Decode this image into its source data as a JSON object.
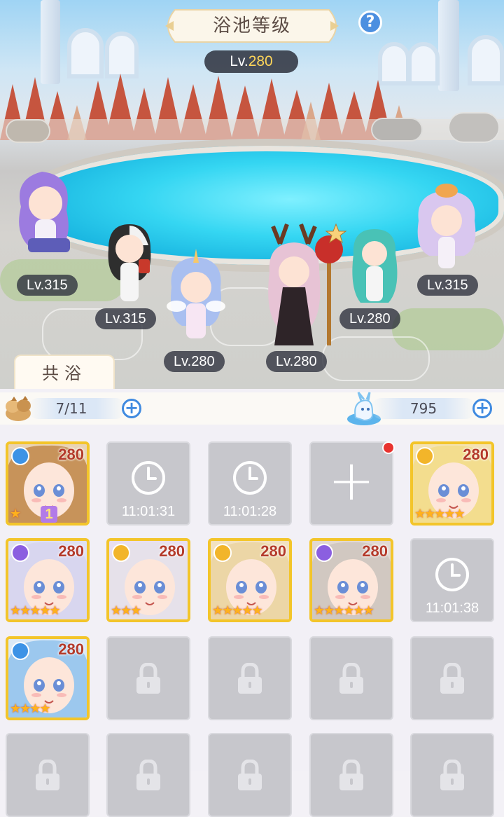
{
  "header": {
    "title": "浴池等级",
    "help_label": "?",
    "pool_level_prefix": "Lv.",
    "pool_level_value": "280"
  },
  "characters": [
    {
      "level": "Lv.315",
      "hair": "#9c7be0"
    },
    {
      "level": "Lv.315",
      "hair": "#2e2e2e"
    },
    {
      "level": "Lv.280",
      "hair": "#a9bff0"
    },
    {
      "level": "Lv.280",
      "hair": "#e7c3d5"
    },
    {
      "level": "Lv.280",
      "hair": "#49c2b6"
    },
    {
      "level": "Lv.315",
      "hair": "#d9c7ef"
    }
  ],
  "tab": {
    "label": "共浴"
  },
  "resources": {
    "capacity": {
      "icon": "supply-bag-icon",
      "value": "7/11"
    },
    "energy": {
      "icon": "water-spirit-icon",
      "value": "795"
    }
  },
  "slots": [
    {
      "type": "card",
      "level": "280",
      "stars": "★",
      "extra": "1",
      "badge_color": "#3d93e6",
      "hair": "#c7935a",
      "bg": "#e9d3b5"
    },
    {
      "type": "timer",
      "time": "11:01:31"
    },
    {
      "type": "timer",
      "time": "11:01:28"
    },
    {
      "type": "add",
      "label": "+"
    },
    {
      "type": "card",
      "level": "280",
      "stars": "★★★★★",
      "badge_color": "#f2b52a",
      "hair": "#f3dd8e",
      "bg": "#f4e3b2"
    },
    {
      "type": "card",
      "level": "280",
      "stars": "★★★★★",
      "badge_color": "#8b5fe0",
      "hair": "#d8d6ef",
      "bg": "#dfe1f2"
    },
    {
      "type": "card",
      "level": "280",
      "stars": "★★★",
      "badge_color": "#f2b52a",
      "hair": "#e6e1ea",
      "bg": "#e9dff0"
    },
    {
      "type": "card",
      "level": "280",
      "stars": "★★★★★",
      "badge_color": "#f2b52a",
      "hair": "#ecd6a6",
      "bg": "#f2e2c2"
    },
    {
      "type": "card",
      "level": "280",
      "stars": "★★★★★★",
      "badge_color": "#8b5fe0",
      "hair": "#d1c8c1",
      "bg": "#e2d9d2"
    },
    {
      "type": "timer",
      "time": "11:01:38"
    },
    {
      "type": "card",
      "level": "280",
      "stars": "★★★★",
      "badge_color": "#3d93e6",
      "hair": "#9cc8ee",
      "bg": "#dbe9f6"
    },
    {
      "type": "locked"
    },
    {
      "type": "locked"
    },
    {
      "type": "locked"
    },
    {
      "type": "locked"
    },
    {
      "type": "locked"
    },
    {
      "type": "locked"
    },
    {
      "type": "locked"
    },
    {
      "type": "locked"
    },
    {
      "type": "locked"
    }
  ]
}
